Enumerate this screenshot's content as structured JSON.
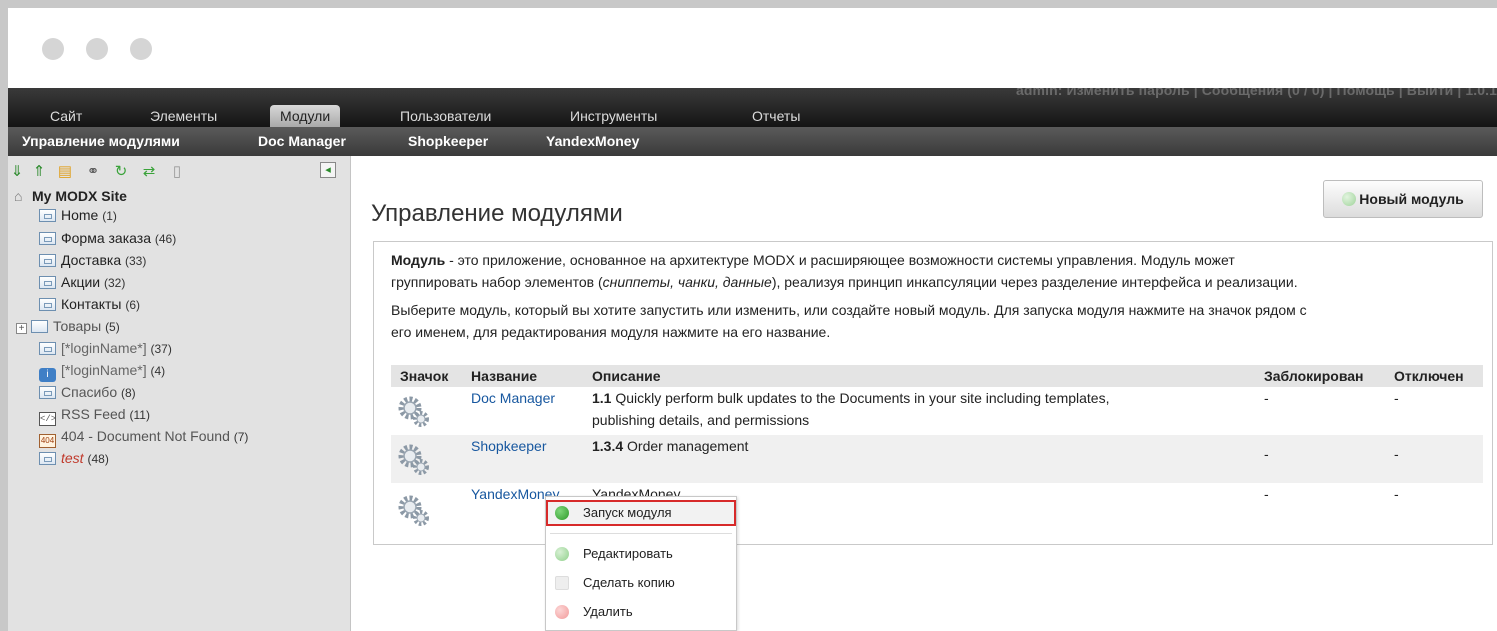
{
  "window": {
    "controls": [
      "close",
      "minimize",
      "maximize"
    ]
  },
  "header": {
    "user_line": "admin: Изменить пароль | Сообщения (0 / 0) | Помощь | Выйти | 1.0.1",
    "tabs": [
      {
        "label": "Сайт",
        "active": false
      },
      {
        "label": "Элементы",
        "active": false
      },
      {
        "label": "Модули",
        "active": true
      },
      {
        "label": "Пользователи",
        "active": false
      },
      {
        "label": "Инструменты",
        "active": false
      },
      {
        "label": "Отчеты",
        "active": false
      }
    ],
    "subtabs": [
      "Управление модулями",
      "Doc Manager",
      "Shopkeeper",
      "YandexMoney"
    ]
  },
  "sidebar": {
    "toolbar_icons": [
      "expand-all-icon",
      "collapse-all-icon",
      "new-document-icon",
      "new-weblink-icon",
      "refresh-icon",
      "sort-icon",
      "trash-icon",
      "hide-tree-icon"
    ],
    "root": "My MODX Site",
    "items": [
      {
        "title": "Home",
        "count": "(1)",
        "icon": "home"
      },
      {
        "title": "Форма заказа",
        "count": "(46)",
        "icon": "page"
      },
      {
        "title": "Доставка",
        "count": "(33)",
        "icon": "page"
      },
      {
        "title": "Акции",
        "count": "(32)",
        "icon": "page"
      },
      {
        "title": "Контакты",
        "count": "(6)",
        "icon": "page"
      },
      {
        "title": "Товары",
        "count": "(5)",
        "icon": "folder"
      },
      {
        "title": "[*loginName*]",
        "count": "(37)",
        "icon": "page"
      },
      {
        "title": "[*loginName*]",
        "count": "(4)",
        "icon": "info"
      },
      {
        "title": "Спасибо",
        "count": "(8)",
        "icon": "page"
      },
      {
        "title": "RSS Feed",
        "count": "(11)",
        "icon": "xml"
      },
      {
        "title": "404 - Document Not Found",
        "count": "(7)",
        "icon": "404"
      },
      {
        "title": "test",
        "count": "(48)",
        "icon": "page"
      }
    ]
  },
  "main": {
    "title": "Управление модулями",
    "new_button": "Новый модуль",
    "intro_bold": "Модуль",
    "intro_1": " - это приложение, основанное на архитектуре MODX и расширяющее возможности системы управления. Модуль может",
    "intro_2a": "группировать набор элементов (",
    "intro_2_italic": "сниппеты, чанки, данные",
    "intro_2b": "), реализуя принцип инкапсуляции через разделение интерфейса и реализации.",
    "intro_3": "Выберите модуль, который вы хотите запустить или изменить, или создайте новый модуль. Для запуска модуля нажмите на значок рядом с",
    "intro_4": "его именем, для редактирования модуля нажмите на его название.",
    "table": {
      "headers": [
        "Значок",
        "Название",
        "Описание",
        "Заблокирован",
        "Отключен"
      ],
      "rows": [
        {
          "name": "Doc Manager",
          "version": "1.1",
          "desc_1": " Quickly perform bulk updates to the Documents in your site including templates,",
          "desc_2": "publishing details, and permissions",
          "locked": "-",
          "disabled": "-"
        },
        {
          "name": "Shopkeeper",
          "version": "1.3.4",
          "desc_1": " Order management",
          "desc_2": "",
          "locked": "-",
          "disabled": "-"
        },
        {
          "name": "YandexMoney",
          "version": "",
          "desc_1": "YandexMoney",
          "desc_2": "",
          "locked": "-",
          "disabled": "-"
        }
      ]
    }
  },
  "context_menu": {
    "items": [
      {
        "label": "Запуск модуля",
        "color": "#3aaa35",
        "highlighted": true
      },
      {
        "label": "Редактировать",
        "color": "#8fd08a",
        "highlighted": false
      },
      {
        "label": "Сделать копию",
        "color": "#dddddd",
        "highlighted": false
      },
      {
        "label": "Удалить",
        "color": "#f29a9a",
        "highlighted": false
      }
    ]
  }
}
